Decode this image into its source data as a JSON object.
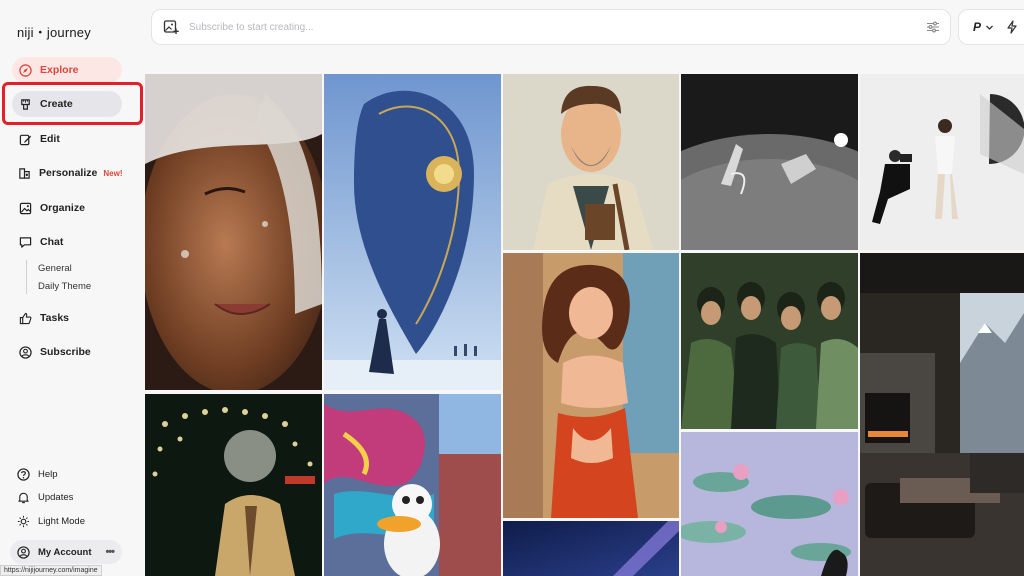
{
  "app": {
    "logo": "niji・journey"
  },
  "sidebar": {
    "items": [
      {
        "label": "Explore",
        "icon": "compass-icon"
      },
      {
        "label": "Create",
        "icon": "brush-icon"
      },
      {
        "label": "Edit",
        "icon": "edit-icon"
      },
      {
        "label": "Personalize",
        "icon": "personalize-icon",
        "badge": "New!"
      },
      {
        "label": "Organize",
        "icon": "image-icon"
      },
      {
        "label": "Chat",
        "icon": "chat-icon"
      },
      {
        "label": "Tasks",
        "icon": "thumbs-up-icon"
      },
      {
        "label": "Subscribe",
        "icon": "account-circle-icon"
      }
    ],
    "chat_channels": [
      "General",
      "Daily Theme"
    ],
    "bottom": [
      {
        "label": "Help",
        "icon": "help-icon"
      },
      {
        "label": "Updates",
        "icon": "bell-icon"
      },
      {
        "label": "Light Mode",
        "icon": "sun-icon"
      }
    ],
    "account": {
      "label": "My Account",
      "more": "•••"
    }
  },
  "topbar": {
    "prompt_placeholder": "Subscribe to start creating...",
    "mode_label": "P"
  },
  "status_url": "https://nijijourney.com/imagine",
  "colors": {
    "accent": "#e0453a",
    "highlight": "#e3202a"
  }
}
